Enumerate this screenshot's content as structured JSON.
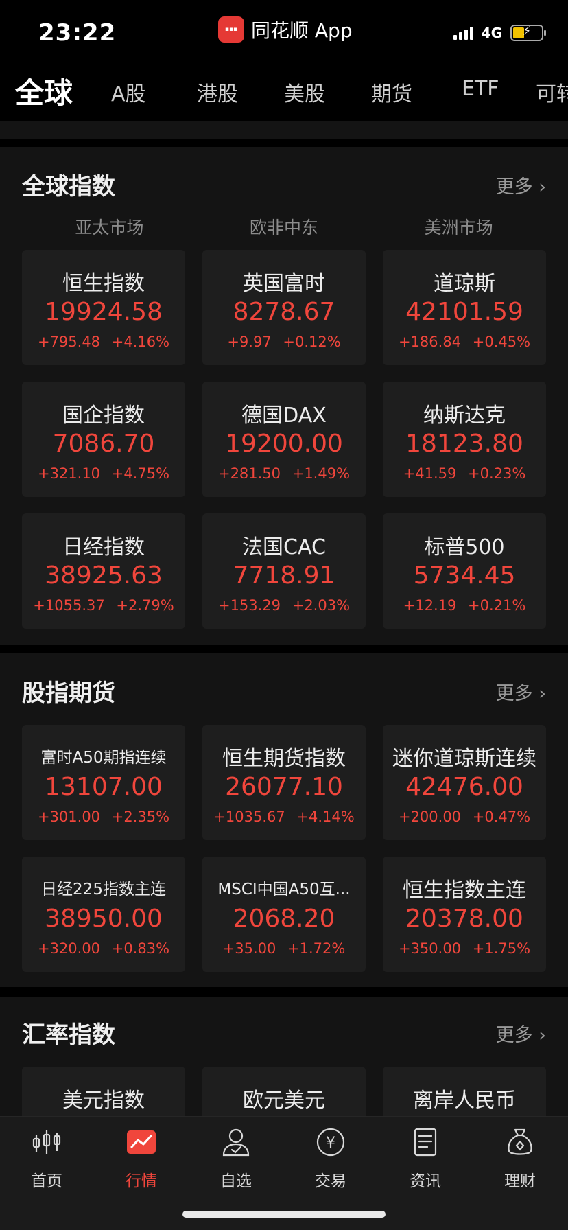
{
  "status_bar": {
    "time": "23:22",
    "app_name": "同花顺 App",
    "network": "4G"
  },
  "top_tabs": [
    "全球",
    "A股",
    "港股",
    "美股",
    "期货",
    "ETF",
    "可转"
  ],
  "global_indices": {
    "title": "全球指数",
    "more": "更多 ›",
    "regions": [
      "亚太市场",
      "欧非中东",
      "美洲市场"
    ],
    "cards": [
      {
        "name": "恒生指数",
        "price": "19924.58",
        "change": "+795.48 +4.16%"
      },
      {
        "name": "英国富时",
        "price": "8278.67",
        "change": "+9.97 +0.12%"
      },
      {
        "name": "道琼斯",
        "price": "42101.59",
        "change": "+186.84 +0.45%"
      },
      {
        "name": "国企指数",
        "price": "7086.70",
        "change": "+321.10 +4.75%"
      },
      {
        "name": "德国DAX",
        "price": "19200.00",
        "change": "+281.50 +1.49%"
      },
      {
        "name": "纳斯达克",
        "price": "18123.80",
        "change": "+41.59 +0.23%"
      },
      {
        "name": "日经指数",
        "price": "38925.63",
        "change": "+1055.37 +2.79%"
      },
      {
        "name": "法国CAC",
        "price": "7718.91",
        "change": "+153.29 +2.03%"
      },
      {
        "name": "标普500",
        "price": "5734.45",
        "change": "+12.19 +0.21%"
      }
    ]
  },
  "index_futures": {
    "title": "股指期货",
    "more": "更多 ›",
    "cards": [
      {
        "name": "富时A50期指连续",
        "price": "13107.00",
        "change": "+301.00 +2.35%"
      },
      {
        "name": "恒生期货指数",
        "price": "26077.10",
        "change": "+1035.67 +4.14%"
      },
      {
        "name": "迷你道琼斯连续",
        "price": "42476.00",
        "change": "+200.00 +0.47%"
      },
      {
        "name": "日经225指数主连",
        "price": "38950.00",
        "change": "+320.00 +0.83%"
      },
      {
        "name": "MSCI中国A50互...",
        "price": "2068.20",
        "change": "+35.00 +1.72%"
      },
      {
        "name": "恒生指数主连",
        "price": "20378.00",
        "change": "+350.00 +1.75%"
      }
    ]
  },
  "fx_indices": {
    "title": "汇率指数",
    "more": "更多 ›",
    "cards": [
      {
        "name": "美元指数"
      },
      {
        "name": "欧元美元"
      },
      {
        "name": "离岸人民币"
      }
    ]
  },
  "bottom_nav": [
    {
      "label": "首页",
      "icon": "candlestick-icon"
    },
    {
      "label": "行情",
      "icon": "market-chart-icon"
    },
    {
      "label": "自选",
      "icon": "user-check-icon"
    },
    {
      "label": "交易",
      "icon": "yen-circle-icon"
    },
    {
      "label": "资讯",
      "icon": "document-icon"
    },
    {
      "label": "理财",
      "icon": "money-bag-icon"
    }
  ],
  "colors": {
    "up": "#f0463c",
    "background": "#000000",
    "card": "#1e1e1e",
    "accent": "#e53935"
  }
}
